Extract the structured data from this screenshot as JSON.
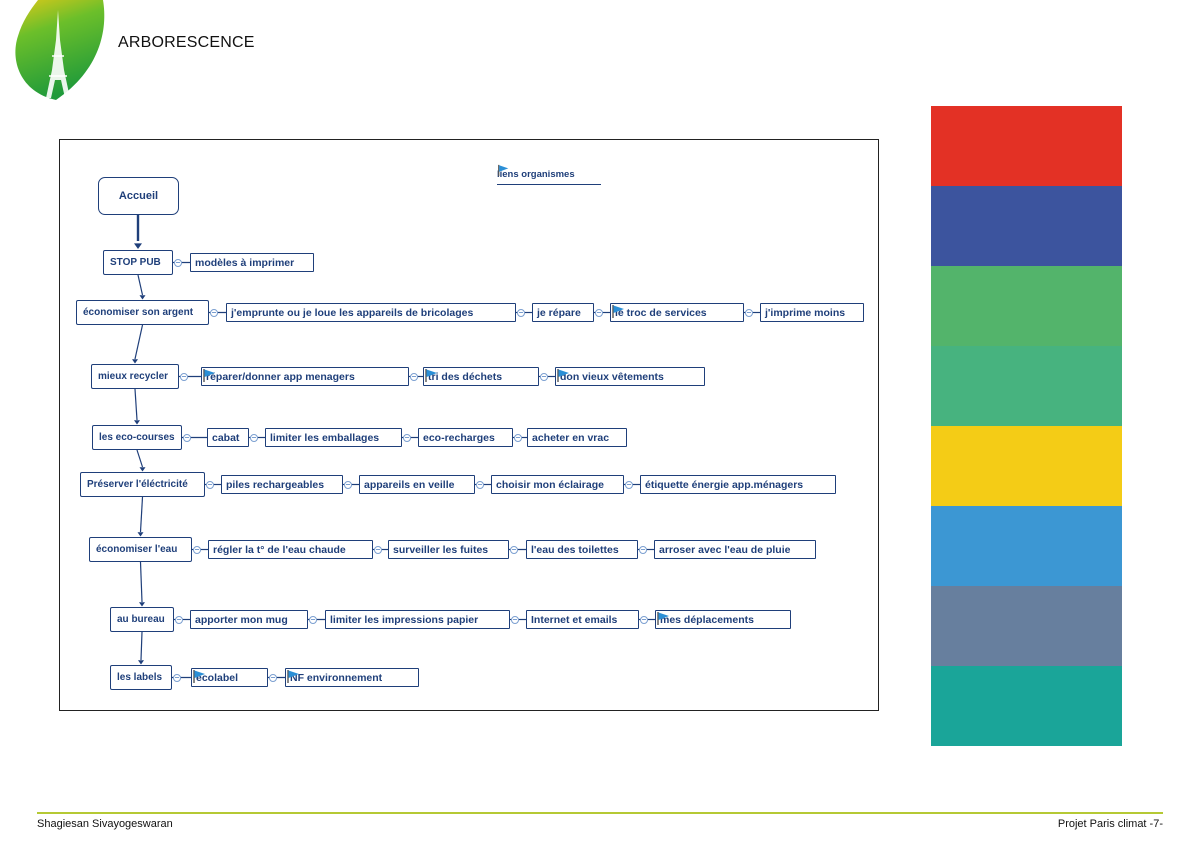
{
  "header": {
    "title": "ARBORESCENCE"
  },
  "legend": {
    "label": "liens organismes"
  },
  "tree": {
    "home": "Accueil",
    "rows": [
      {
        "label": "STOP PUB",
        "children": [
          {
            "label": "modèles à imprimer",
            "flag": false
          }
        ]
      },
      {
        "label": "économiser son argent",
        "children": [
          {
            "label": "j'emprunte ou je loue les appareils de bricolages",
            "flag": false
          },
          {
            "label": "je répare",
            "flag": false
          },
          {
            "label": "le troc de services",
            "flag": true
          },
          {
            "label": "j'imprime moins",
            "flag": false
          }
        ]
      },
      {
        "label": "mieux recycler",
        "children": [
          {
            "label": "réparer/donner app menagers",
            "flag": true
          },
          {
            "label": "tri des déchets",
            "flag": true
          },
          {
            "label": "don vieux vêtements",
            "flag": true
          }
        ]
      },
      {
        "label": "les eco-courses",
        "children": [
          {
            "label": "cabat",
            "flag": false
          },
          {
            "label": "limiter les emballages",
            "flag": false
          },
          {
            "label": "eco-recharges",
            "flag": false
          },
          {
            "label": "acheter en vrac",
            "flag": false
          }
        ]
      },
      {
        "label": "Préserver l'éléctricité",
        "children": [
          {
            "label": "piles rechargeables",
            "flag": false
          },
          {
            "label": "appareils en veille",
            "flag": false
          },
          {
            "label": "choisir mon éclairage",
            "flag": false
          },
          {
            "label": "étiquette énergie app.ménagers",
            "flag": false
          }
        ]
      },
      {
        "label": "économiser l'eau",
        "children": [
          {
            "label": "régler la t° de l'eau chaude",
            "flag": false
          },
          {
            "label": "surveiller les fuites",
            "flag": false
          },
          {
            "label": "l'eau des toilettes",
            "flag": false
          },
          {
            "label": "arroser avec l'eau de pluie",
            "flag": false
          }
        ]
      },
      {
        "label": "au bureau",
        "children": [
          {
            "label": "apporter mon mug",
            "flag": false
          },
          {
            "label": "limiter les impressions papier",
            "flag": false
          },
          {
            "label": "Internet et emails",
            "flag": false
          },
          {
            "label": "mes déplacements",
            "flag": true
          }
        ]
      },
      {
        "label": "les labels",
        "children": [
          {
            "label": "ecolabel",
            "flag": true
          },
          {
            "label": "NF environnement",
            "flag": true
          }
        ]
      }
    ]
  },
  "palette": [
    "#e33125",
    "#3c549e",
    "#53b46b",
    "#47b37f",
    "#f4cc16",
    "#3c97d3",
    "#677f9e",
    "#1aa599"
  ],
  "footer": {
    "author": "Shagiesan Sivayogeswaran",
    "project": "Projet Paris climat -7-"
  }
}
